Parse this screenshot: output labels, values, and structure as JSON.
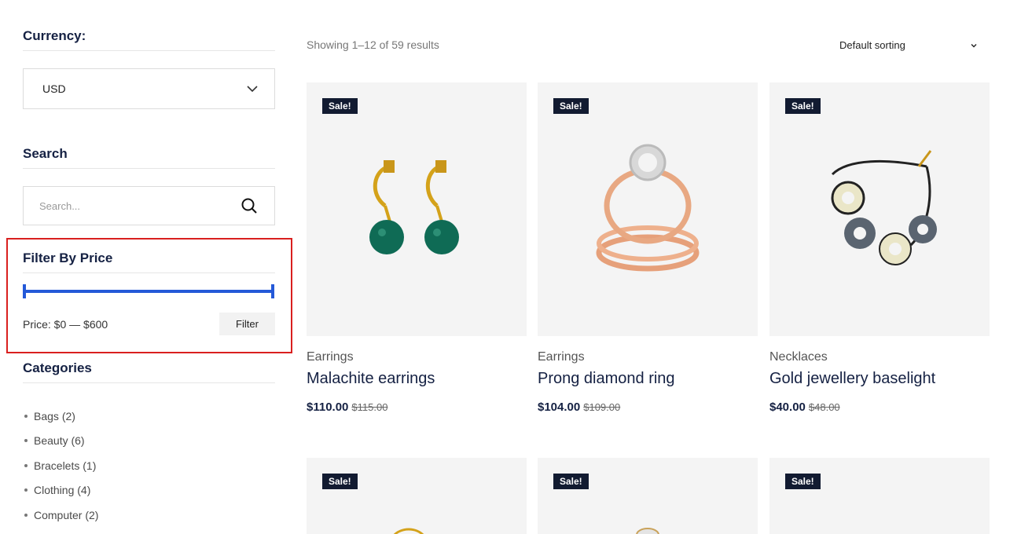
{
  "sidebar": {
    "currency": {
      "title": "Currency:",
      "selected": "USD"
    },
    "search": {
      "title": "Search",
      "placeholder": "Search..."
    },
    "price_filter": {
      "title": "Filter By Price",
      "price_label": "Price: $0 — $600",
      "button_label": "Filter",
      "min_fraction": 0,
      "max_fraction": 1
    },
    "categories": {
      "title": "Categories",
      "items": [
        {
          "label": "Bags",
          "count": "(2)"
        },
        {
          "label": "Beauty",
          "count": "(6)"
        },
        {
          "label": "Bracelets",
          "count": "(1)"
        },
        {
          "label": "Clothing",
          "count": "(4)"
        },
        {
          "label": "Computer",
          "count": "(2)"
        }
      ]
    }
  },
  "main": {
    "results_text": "Showing 1–12 of 59 results",
    "sorting": "Default sorting",
    "products": [
      {
        "badge": "Sale!",
        "category": "Earrings",
        "name": "Malachite earrings",
        "price": "$110.00",
        "old_price": "$115.00"
      },
      {
        "badge": "Sale!",
        "category": "Earrings",
        "name": "Prong diamond ring",
        "price": "$104.00",
        "old_price": "$109.00"
      },
      {
        "badge": "Sale!",
        "category": "Necklaces",
        "name": "Gold jewellery baselight",
        "price": "$40.00",
        "old_price": "$48.00"
      }
    ],
    "products_row2": [
      {
        "badge": "Sale!"
      },
      {
        "badge": "Sale!"
      },
      {
        "badge": "Sale!"
      }
    ]
  },
  "colors": {
    "accent": "#2459d8",
    "highlight": "#d9201f",
    "badge_bg": "#121b31",
    "title": "#152143"
  }
}
